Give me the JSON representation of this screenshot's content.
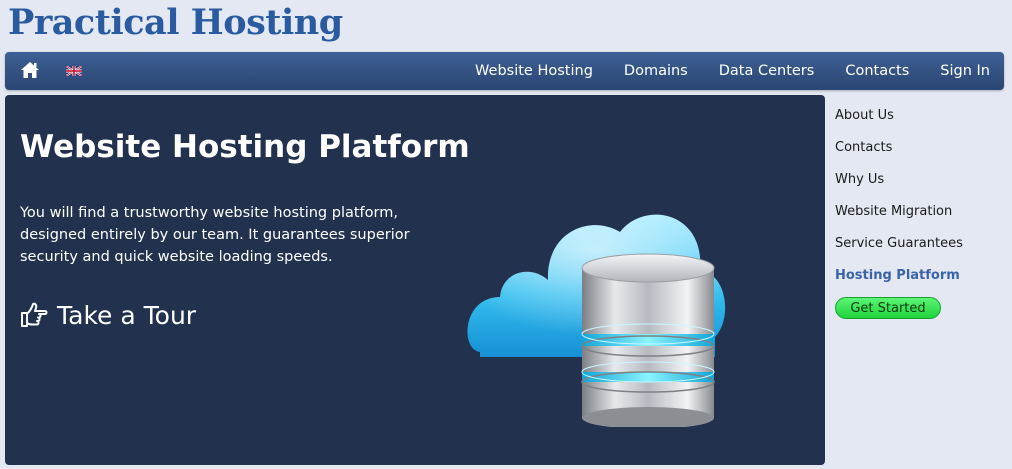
{
  "logo": "Practical Hosting",
  "nav": {
    "home_icon": "home-icon",
    "flag_icon": "uk-flag-icon",
    "links": [
      "Website Hosting",
      "Domains",
      "Data Centers",
      "Contacts",
      "Sign In"
    ]
  },
  "hero": {
    "title": "Website Hosting Platform",
    "description": "You will find a trustworthy website hosting platform, designed entirely by our team. It guarantees superior security and quick website loading speeds.",
    "tour_icon": "thumbs-up-pointing-icon",
    "tour_label": "Take a Tour",
    "art": "cloud-server-illustration"
  },
  "sidebar": {
    "items": [
      "About Us",
      "Contacts",
      "Why Us",
      "Website Migration",
      "Service Guarantees",
      "Hosting Platform"
    ],
    "active": "Hosting Platform",
    "cta": "Get Started"
  },
  "colors": {
    "background": "#e3e8f2",
    "logo": "#2a5aa0",
    "navbar": "#34527f",
    "hero": "#22324e",
    "active_link": "#3a64a8",
    "cta": "#22d33c"
  }
}
